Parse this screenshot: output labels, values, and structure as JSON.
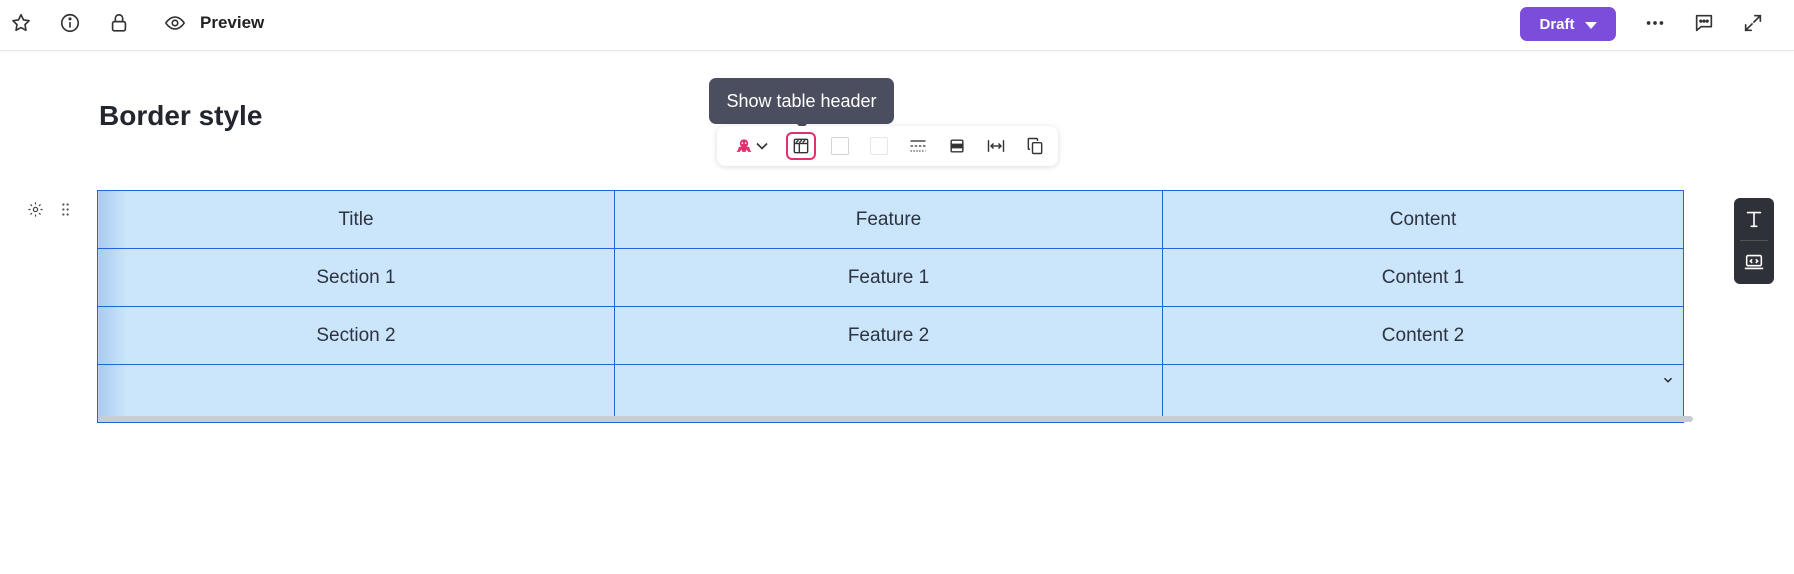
{
  "topbar": {
    "preview_label": "Preview",
    "draft_label": "Draft",
    "accent_color": "#7c4ddb"
  },
  "page": {
    "title": "Border style"
  },
  "tooltip": {
    "text": "Show table header"
  },
  "table_toolbar": {
    "items": [
      "brand-icon",
      "chevron-down-icon",
      "table-header-icon",
      "border-swatch",
      "fill-swatch",
      "border-style-icon",
      "row-height-icon",
      "fit-width-icon",
      "copy-icon"
    ],
    "active": "table-header-icon",
    "active_color": "#e0316e"
  },
  "table": {
    "rows": [
      [
        "Title",
        "Feature",
        "Content"
      ],
      [
        "Section 1",
        "Feature 1",
        "Content 1"
      ],
      [
        "Section 2",
        "Feature 2",
        "Content 2"
      ],
      [
        "",
        "",
        ""
      ]
    ],
    "border_color": "#2563d8",
    "cell_color": "#cbe5fb"
  },
  "side_panel": {
    "items": [
      "text-icon",
      "embed-icon"
    ]
  }
}
